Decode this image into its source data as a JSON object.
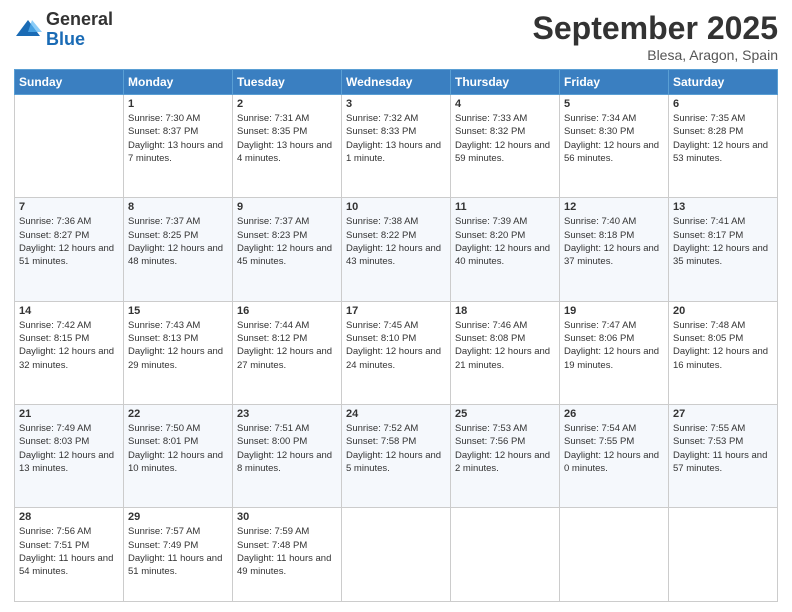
{
  "header": {
    "logo_general": "General",
    "logo_blue": "Blue",
    "month_title": "September 2025",
    "location": "Blesa, Aragon, Spain"
  },
  "days_header": [
    "Sunday",
    "Monday",
    "Tuesday",
    "Wednesday",
    "Thursday",
    "Friday",
    "Saturday"
  ],
  "weeks": [
    [
      {
        "day": "",
        "sunrise": "",
        "sunset": "",
        "daylight": ""
      },
      {
        "day": "1",
        "sunrise": "Sunrise: 7:30 AM",
        "sunset": "Sunset: 8:37 PM",
        "daylight": "Daylight: 13 hours and 7 minutes."
      },
      {
        "day": "2",
        "sunrise": "Sunrise: 7:31 AM",
        "sunset": "Sunset: 8:35 PM",
        "daylight": "Daylight: 13 hours and 4 minutes."
      },
      {
        "day": "3",
        "sunrise": "Sunrise: 7:32 AM",
        "sunset": "Sunset: 8:33 PM",
        "daylight": "Daylight: 13 hours and 1 minute."
      },
      {
        "day": "4",
        "sunrise": "Sunrise: 7:33 AM",
        "sunset": "Sunset: 8:32 PM",
        "daylight": "Daylight: 12 hours and 59 minutes."
      },
      {
        "day": "5",
        "sunrise": "Sunrise: 7:34 AM",
        "sunset": "Sunset: 8:30 PM",
        "daylight": "Daylight: 12 hours and 56 minutes."
      },
      {
        "day": "6",
        "sunrise": "Sunrise: 7:35 AM",
        "sunset": "Sunset: 8:28 PM",
        "daylight": "Daylight: 12 hours and 53 minutes."
      }
    ],
    [
      {
        "day": "7",
        "sunrise": "Sunrise: 7:36 AM",
        "sunset": "Sunset: 8:27 PM",
        "daylight": "Daylight: 12 hours and 51 minutes."
      },
      {
        "day": "8",
        "sunrise": "Sunrise: 7:37 AM",
        "sunset": "Sunset: 8:25 PM",
        "daylight": "Daylight: 12 hours and 48 minutes."
      },
      {
        "day": "9",
        "sunrise": "Sunrise: 7:37 AM",
        "sunset": "Sunset: 8:23 PM",
        "daylight": "Daylight: 12 hours and 45 minutes."
      },
      {
        "day": "10",
        "sunrise": "Sunrise: 7:38 AM",
        "sunset": "Sunset: 8:22 PM",
        "daylight": "Daylight: 12 hours and 43 minutes."
      },
      {
        "day": "11",
        "sunrise": "Sunrise: 7:39 AM",
        "sunset": "Sunset: 8:20 PM",
        "daylight": "Daylight: 12 hours and 40 minutes."
      },
      {
        "day": "12",
        "sunrise": "Sunrise: 7:40 AM",
        "sunset": "Sunset: 8:18 PM",
        "daylight": "Daylight: 12 hours and 37 minutes."
      },
      {
        "day": "13",
        "sunrise": "Sunrise: 7:41 AM",
        "sunset": "Sunset: 8:17 PM",
        "daylight": "Daylight: 12 hours and 35 minutes."
      }
    ],
    [
      {
        "day": "14",
        "sunrise": "Sunrise: 7:42 AM",
        "sunset": "Sunset: 8:15 PM",
        "daylight": "Daylight: 12 hours and 32 minutes."
      },
      {
        "day": "15",
        "sunrise": "Sunrise: 7:43 AM",
        "sunset": "Sunset: 8:13 PM",
        "daylight": "Daylight: 12 hours and 29 minutes."
      },
      {
        "day": "16",
        "sunrise": "Sunrise: 7:44 AM",
        "sunset": "Sunset: 8:12 PM",
        "daylight": "Daylight: 12 hours and 27 minutes."
      },
      {
        "day": "17",
        "sunrise": "Sunrise: 7:45 AM",
        "sunset": "Sunset: 8:10 PM",
        "daylight": "Daylight: 12 hours and 24 minutes."
      },
      {
        "day": "18",
        "sunrise": "Sunrise: 7:46 AM",
        "sunset": "Sunset: 8:08 PM",
        "daylight": "Daylight: 12 hours and 21 minutes."
      },
      {
        "day": "19",
        "sunrise": "Sunrise: 7:47 AM",
        "sunset": "Sunset: 8:06 PM",
        "daylight": "Daylight: 12 hours and 19 minutes."
      },
      {
        "day": "20",
        "sunrise": "Sunrise: 7:48 AM",
        "sunset": "Sunset: 8:05 PM",
        "daylight": "Daylight: 12 hours and 16 minutes."
      }
    ],
    [
      {
        "day": "21",
        "sunrise": "Sunrise: 7:49 AM",
        "sunset": "Sunset: 8:03 PM",
        "daylight": "Daylight: 12 hours and 13 minutes."
      },
      {
        "day": "22",
        "sunrise": "Sunrise: 7:50 AM",
        "sunset": "Sunset: 8:01 PM",
        "daylight": "Daylight: 12 hours and 10 minutes."
      },
      {
        "day": "23",
        "sunrise": "Sunrise: 7:51 AM",
        "sunset": "Sunset: 8:00 PM",
        "daylight": "Daylight: 12 hours and 8 minutes."
      },
      {
        "day": "24",
        "sunrise": "Sunrise: 7:52 AM",
        "sunset": "Sunset: 7:58 PM",
        "daylight": "Daylight: 12 hours and 5 minutes."
      },
      {
        "day": "25",
        "sunrise": "Sunrise: 7:53 AM",
        "sunset": "Sunset: 7:56 PM",
        "daylight": "Daylight: 12 hours and 2 minutes."
      },
      {
        "day": "26",
        "sunrise": "Sunrise: 7:54 AM",
        "sunset": "Sunset: 7:55 PM",
        "daylight": "Daylight: 12 hours and 0 minutes."
      },
      {
        "day": "27",
        "sunrise": "Sunrise: 7:55 AM",
        "sunset": "Sunset: 7:53 PM",
        "daylight": "Daylight: 11 hours and 57 minutes."
      }
    ],
    [
      {
        "day": "28",
        "sunrise": "Sunrise: 7:56 AM",
        "sunset": "Sunset: 7:51 PM",
        "daylight": "Daylight: 11 hours and 54 minutes."
      },
      {
        "day": "29",
        "sunrise": "Sunrise: 7:57 AM",
        "sunset": "Sunset: 7:49 PM",
        "daylight": "Daylight: 11 hours and 51 minutes."
      },
      {
        "day": "30",
        "sunrise": "Sunrise: 7:59 AM",
        "sunset": "Sunset: 7:48 PM",
        "daylight": "Daylight: 11 hours and 49 minutes."
      },
      {
        "day": "",
        "sunrise": "",
        "sunset": "",
        "daylight": ""
      },
      {
        "day": "",
        "sunrise": "",
        "sunset": "",
        "daylight": ""
      },
      {
        "day": "",
        "sunrise": "",
        "sunset": "",
        "daylight": ""
      },
      {
        "day": "",
        "sunrise": "",
        "sunset": "",
        "daylight": ""
      }
    ]
  ]
}
